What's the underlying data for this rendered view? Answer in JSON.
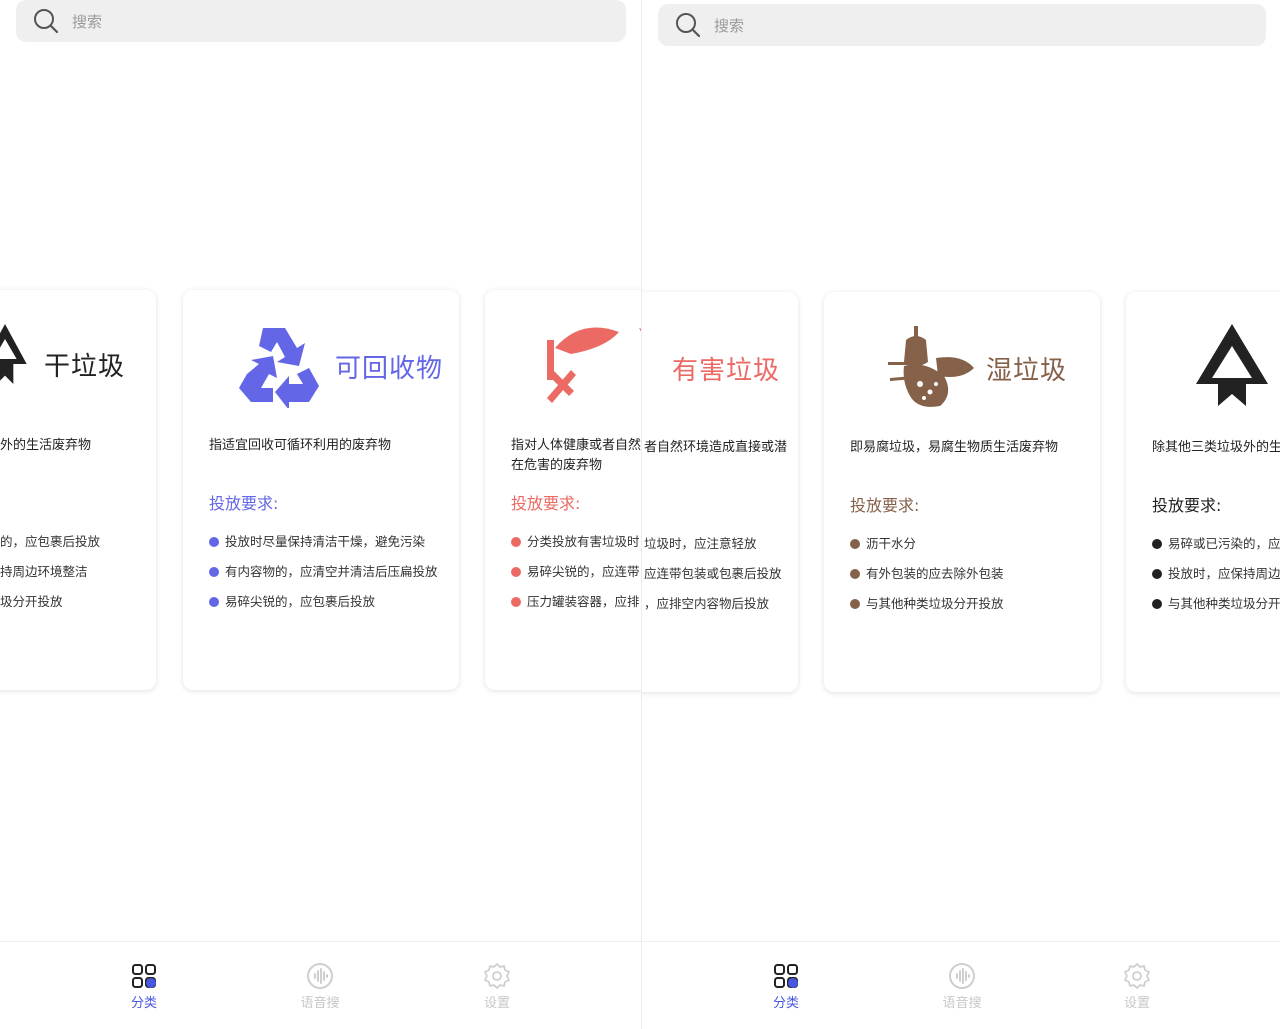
{
  "search": {
    "placeholder": "搜索"
  },
  "tabs": [
    {
      "label": "分类",
      "icon": "grid-icon",
      "active": true
    },
    {
      "label": "语音搜",
      "icon": "voice-icon",
      "active": false
    },
    {
      "label": "设置",
      "icon": "gear-icon",
      "active": false
    }
  ],
  "colors": {
    "recyclable": "#6366e6",
    "hazardous": "#eb6a63",
    "wet": "#85614a",
    "dry": "#222222",
    "tab_active": "#4a56e0"
  },
  "left": {
    "dry_partial": {
      "title": "干垃圾",
      "desc": "外的生活废弃物",
      "items": [
        "的，应包裹后投放",
        "持周边环境整洁",
        "圾分开投放"
      ]
    },
    "recyclable": {
      "title": "可回收物",
      "desc": "指适宜回收可循环利用的废弃物",
      "req": "投放要求:",
      "items": [
        "投放时尽量保持清洁干燥，避免污染",
        "有内容物的，应清空并清洁后压扁投放",
        "易碎尖锐的，应包裹后投放"
      ]
    },
    "hazardous_partial": {
      "desc": "指对人体健康或者自然",
      "desc2": "在危害的废弃物",
      "req": "投放要求:",
      "items": [
        "分类投放有害垃圾时",
        "易碎尖锐的，应连带",
        "压力罐装容器，应排"
      ]
    }
  },
  "right": {
    "hazardous_partial": {
      "title": "有害垃圾",
      "desc": "者自然环境造成直接或潜",
      "items": [
        "垃圾时，应注意轻放",
        "应连带包装或包裹后投放",
        "，应排空内容物后投放"
      ]
    },
    "wet": {
      "title": "湿垃圾",
      "desc": "即易腐垃圾，易腐生物质生活废弃物",
      "req": "投放要求:",
      "items": [
        "沥干水分",
        "有外包装的应去除外包装",
        "与其他种类垃圾分开投放"
      ]
    },
    "dry_partial": {
      "desc": "除其他三类垃圾外的生",
      "req": "投放要求:",
      "items": [
        "易碎或已污染的，应",
        "投放时，应保持周边",
        "与其他种类垃圾分开"
      ]
    }
  }
}
